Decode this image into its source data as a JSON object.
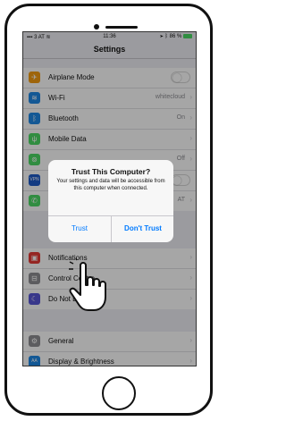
{
  "status": {
    "carrier": "3 AT",
    "time": "11:36",
    "battery": "86 %"
  },
  "nav": {
    "title": "Settings"
  },
  "rows_group1": [
    {
      "name": "airplane-mode",
      "icon": "airplane-icon",
      "glyph": "✈",
      "color": "#f39c12",
      "label": "Airplane Mode",
      "value": "",
      "control": "toggle"
    },
    {
      "name": "wifi",
      "icon": "wifi-icon",
      "glyph": "≋",
      "color": "#1e88e5",
      "label": "Wi-Fi",
      "value": "whitecloud",
      "control": "chevron"
    },
    {
      "name": "bluetooth",
      "icon": "bluetooth-icon",
      "glyph": "ᛒ",
      "color": "#1e88e5",
      "label": "Bluetooth",
      "value": "On",
      "control": "chevron"
    },
    {
      "name": "mobile-data",
      "icon": "antenna-icon",
      "glyph": "ψ",
      "color": "#4cd964",
      "label": "Mobile Data",
      "value": "",
      "control": "chevron"
    },
    {
      "name": "personal-hotspot",
      "icon": "hotspot-icon",
      "glyph": "⊚",
      "color": "#4cd964",
      "label": "",
      "value": "Off",
      "control": "chevron"
    },
    {
      "name": "vpn",
      "icon": "vpn-icon",
      "glyph": "VPN",
      "color": "#1e5bc8",
      "label": "",
      "value": "",
      "control": "toggle"
    },
    {
      "name": "carrier",
      "icon": "phone-icon",
      "glyph": "✆",
      "color": "#4cd964",
      "label": "",
      "value": "AT",
      "control": "chevron"
    }
  ],
  "rows_group2": [
    {
      "name": "notifications",
      "icon": "notifications-icon",
      "glyph": "▣",
      "color": "#e53935",
      "label": "Notifications",
      "value": "",
      "control": "chevron"
    },
    {
      "name": "control-centre",
      "icon": "control-centre-icon",
      "glyph": "⊟",
      "color": "#8e8e93",
      "label": "Control Centre",
      "value": "",
      "control": "chevron"
    },
    {
      "name": "do-not-disturb",
      "icon": "moon-icon",
      "glyph": "☾",
      "color": "#5856d6",
      "label": "Do Not Disturb",
      "value": "",
      "control": "chevron"
    }
  ],
  "rows_group3": [
    {
      "name": "general",
      "icon": "gear-icon",
      "glyph": "⚙",
      "color": "#8e8e93",
      "label": "General",
      "value": "",
      "control": "chevron"
    },
    {
      "name": "display-brightness",
      "icon": "display-icon",
      "glyph": "AA",
      "color": "#1e88e5",
      "label": "Display & Brightness",
      "value": "",
      "control": "chevron"
    }
  ],
  "dialog": {
    "title": "Trust This Computer?",
    "message": "Your settings and data will be accessible from this computer when connected.",
    "trust_label": "Trust",
    "dont_trust_label": "Don't Trust"
  }
}
